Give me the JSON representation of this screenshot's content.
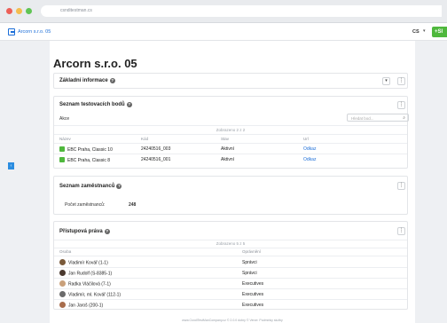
{
  "browser": {
    "url": "csnditestman.cs"
  },
  "colors": {
    "red": "#ed5f57",
    "yellow": "#f4bd4f",
    "green": "#60c454",
    "accent": "#1c6ed8",
    "success": "#4fb83d"
  },
  "app": {
    "title": "Arcorn s.r.o. 05",
    "lang": "CS",
    "lang_chevron": "▾",
    "add_label": "+Sl"
  },
  "page": {
    "title": "Arcorn s.r.o. 05"
  },
  "basic_info": {
    "title": "Základní informace"
  },
  "test_points": {
    "title": "Seznam testovacích bodů",
    "action": "Akce",
    "search_placeholder": "Hledat bod...",
    "shown": "Zobrazeno 2 z 2",
    "columns": [
      "Název",
      "Kód",
      "Stav",
      "Url"
    ],
    "rows": [
      {
        "name": "EBC Praha, Classic 10",
        "code": "24240516_003",
        "status": "Aktivní",
        "url": "Odkaz"
      },
      {
        "name": "EBC Praha, Classic 8",
        "code": "24240516_001",
        "status": "Aktivní",
        "url": "Odkaz"
      }
    ]
  },
  "employees": {
    "title": "Seznam zaměstnanců",
    "count_label": "Počet zaměstnanců:",
    "count_value": "248"
  },
  "access": {
    "title": "Přístupová práva",
    "shown": "Zobrazeno 5 z 5",
    "columns": [
      "Osoba",
      "Oprávnění"
    ],
    "rows": [
      {
        "person": "Vladimír Kovář (1-1)",
        "role": "Správci",
        "avatar": "#7a5a3a"
      },
      {
        "person": "Jan Rudolf (S-8385-1)",
        "role": "Správci",
        "avatar": "#4b3a2f"
      },
      {
        "person": "Radka Vláčilová (7-1)",
        "role": "Executives",
        "avatar": "#c9a07a"
      },
      {
        "person": "Vladimír, ml. Kovář (112-1)",
        "role": "Executives",
        "avatar": "#6b6b6b"
      },
      {
        "person": "Jan Jaroš (200-1)",
        "role": "Executives",
        "avatar": "#a86d4c"
      }
    ]
  },
  "footer": {
    "text": "www.CsndiTestManCompany.cz © 2.0.0 dobry © Verze: Podmínky služby"
  }
}
